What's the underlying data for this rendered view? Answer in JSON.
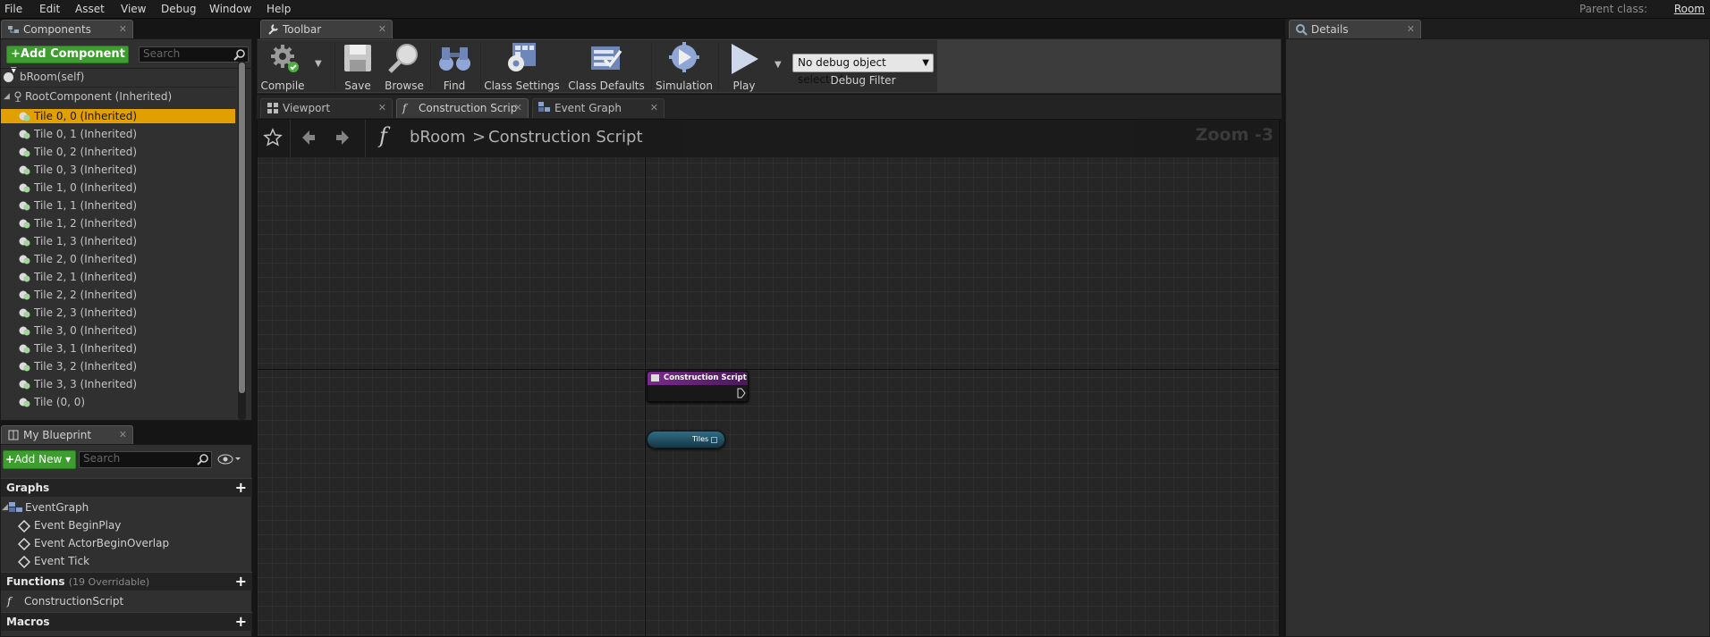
{
  "menu": [
    "File",
    "Edit",
    "Asset",
    "View",
    "Debug",
    "Window",
    "Help"
  ],
  "parent_class": {
    "label": "Parent class:",
    "value": "Room"
  },
  "components_panel": {
    "tab": "Components",
    "add_button": "Add Component",
    "search_placeholder": "Search",
    "self_item": "bRoom(self)",
    "root_item": "RootComponent (Inherited)",
    "items": [
      "Tile 0, 0 (Inherited)",
      "Tile 0, 1 (Inherited)",
      "Tile 0, 2 (Inherited)",
      "Tile 0, 3 (Inherited)",
      "Tile 1, 0 (Inherited)",
      "Tile 1, 1 (Inherited)",
      "Tile 1, 2 (Inherited)",
      "Tile 1, 3 (Inherited)",
      "Tile 2, 0 (Inherited)",
      "Tile 2, 1 (Inherited)",
      "Tile 2, 2 (Inherited)",
      "Tile 2, 3 (Inherited)",
      "Tile 3, 0 (Inherited)",
      "Tile 3, 1 (Inherited)",
      "Tile 3, 2 (Inherited)",
      "Tile 3, 3 (Inherited)",
      "Tile (0, 0)"
    ],
    "selected_index": 0
  },
  "my_blueprint": {
    "tab": "My Blueprint",
    "add_button": "Add New",
    "search_placeholder": "Search",
    "graphs_header": "Graphs",
    "event_graph": "EventGraph",
    "events": [
      "Event BeginPlay",
      "Event ActorBeginOverlap",
      "Event Tick"
    ],
    "functions_header": "Functions",
    "functions_note": "(19 Overridable)",
    "function_items": [
      "ConstructionScript"
    ],
    "macros_header": "Macros"
  },
  "toolbar": {
    "tab": "Toolbar",
    "compile": "Compile",
    "save": "Save",
    "browse": "Browse",
    "find": "Find",
    "class_settings": "Class Settings",
    "class_defaults": "Class Defaults",
    "simulation": "Simulation",
    "play": "Play",
    "debug_object": "No debug object selected",
    "debug_filter": "Debug Filter"
  },
  "editor_tabs": [
    "Viewport",
    "Construction Scrip",
    "Event Graph"
  ],
  "graph": {
    "breadcrumb_class": "bRoom",
    "breadcrumb_sep": ">",
    "breadcrumb_function": "Construction Script",
    "zoom": "Zoom -3",
    "node_title": "Construction Script",
    "var_node": "Tiles"
  },
  "details": {
    "tab": "Details"
  },
  "colors": {
    "accent_selection": "#e2a000",
    "add_green": "#3e9d2f",
    "node_header": "#7a2a8e",
    "var_node": "#2f6d85"
  }
}
